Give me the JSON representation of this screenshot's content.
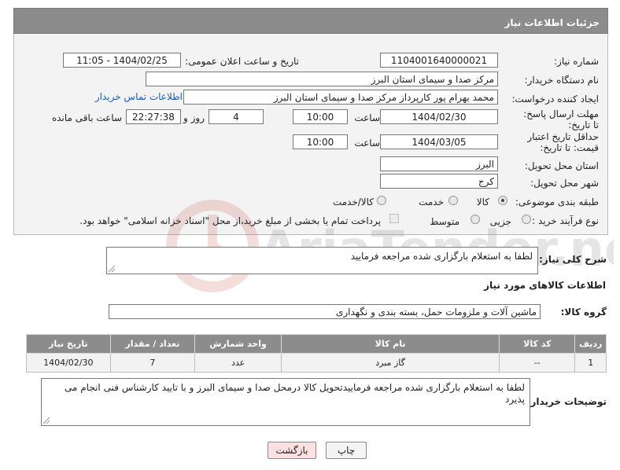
{
  "header": {
    "title": "جزئیات اطلاعات نیاز"
  },
  "fields": {
    "need_number": {
      "label": "شماره نیاز:",
      "value": "1104001640000021"
    },
    "announce_datetime": {
      "label": "تاریخ و ساعت اعلان عمومی:",
      "value": "1404/02/25 - 11:05"
    },
    "buyer_org": {
      "label": "نام دستگاه خریدار:",
      "value": "مرکز صدا و سیمای استان البرز"
    },
    "requester": {
      "label": "ایجاد کننده درخواست:",
      "value": "محمد بهرام پور کارپرداز مرکز صدا و سیمای استان البرز",
      "contact_link": "اطلاعات تماس خریدار"
    },
    "reply_deadline": {
      "label": "مهلت ارسال پاسخ: تا تاریخ:",
      "date": "1404/02/30",
      "time_label": "ساعت",
      "time": "10:00",
      "days": "4",
      "days_label": "روز و",
      "remaining": "22:27:38",
      "remaining_label": "ساعت باقی مانده"
    },
    "price_validity": {
      "label": "حداقل تاریخ اعتبار قیمت: تا تاریخ:",
      "date": "1404/03/05",
      "time_label": "ساعت",
      "time": "10:00"
    },
    "delivery_province": {
      "label": "استان محل تحویل:",
      "value": "البرز"
    },
    "delivery_city": {
      "label": "شهر محل تحویل:",
      "value": "کرج"
    },
    "category": {
      "label": "طبقه بندی موضوعی:",
      "options": [
        "کالا",
        "خدمت",
        "کالا/خدمت"
      ],
      "selected": "کالا"
    },
    "process_type": {
      "label": "نوع فرآیند خرید :",
      "options": [
        "جزیی",
        "متوسط"
      ],
      "selected": "جزیی",
      "note": "پرداخت تمام یا بخشی از مبلغ خرید،از محل \"اسناد خزانه اسلامی\" خواهد بود."
    }
  },
  "description": {
    "label": "شرح کلی نیاز:",
    "value": "لطفا به استعلام بارگزاری شده مراجعه فرمایید"
  },
  "goods_section": {
    "title": "اطلاعات کالاهای مورد نیاز",
    "group_label": "گروه کالا:",
    "group_value": "ماشین آلات و ملزومات حمل، بسته بندی و نگهداری"
  },
  "table": {
    "headers": [
      "ردیف",
      "کد کالا",
      "نام کالا",
      "واحد شمارش",
      "تعداد / مقدار",
      "تاریخ نیاز"
    ],
    "rows": [
      [
        "1",
        "--",
        "گاز مبرد",
        "عدد",
        "7",
        "1404/02/30"
      ]
    ]
  },
  "buyer_notes": {
    "label": "توضیحات خریدار:",
    "value": "لطفا به استعلام بارگزاری شده مراجعه فرماییدتحویل کالا درمحل صدا و سیمای البرز و با تایید کارشناس فنی انجام می پذیرد"
  },
  "buttons": {
    "print": "چاپ",
    "back": "بازگشت"
  },
  "watermark": {
    "text": "AriaTender.neT"
  },
  "colors": {
    "header_bg": "#8c8c8c",
    "panel_bg": "#f3f3f3",
    "link": "#1a5fb4",
    "back_button_bg": "#fde0e0"
  }
}
